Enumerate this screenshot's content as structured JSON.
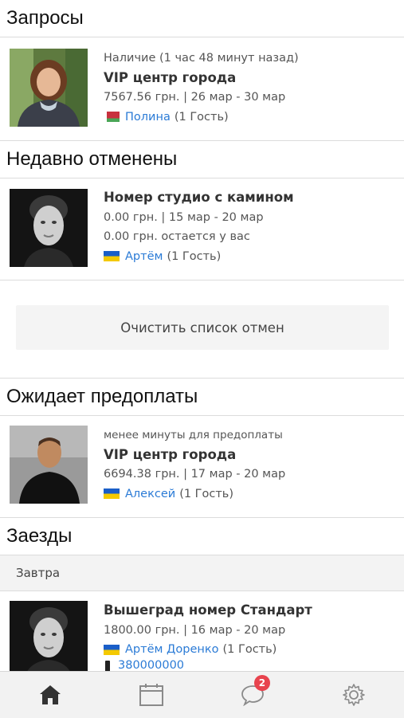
{
  "sections": {
    "requests": {
      "title": "Запросы",
      "card": {
        "status": "Наличие (1 час 48 минут назад)",
        "room": "VIP центр города",
        "price_dates": "7567.56 грн. | 26 мар - 30 мар",
        "flag": "by",
        "guest_name": "Полина",
        "guest_count": "(1 Гость)"
      }
    },
    "cancelled": {
      "title": "Недавно отменены",
      "card": {
        "room": "Номер студио с камином",
        "price_dates": "0.00 грн. | 15 мар - 20 мар",
        "remaining": "0.00 грн. остается у вас",
        "flag": "ua",
        "guest_name": "Артём",
        "guest_count": "(1 Гость)"
      },
      "clear_button": "Очистить список отмен"
    },
    "prepayment": {
      "title": "Ожидает предоплаты",
      "card": {
        "status": "менее минуты для предоплаты",
        "room": "VIP центр города",
        "price_dates": "6694.38 грн. | 17 мар - 20 мар",
        "flag": "ua",
        "guest_name": "Алексей",
        "guest_count": "(1 Гость)"
      }
    },
    "checkins": {
      "title": "Заезды",
      "subheader": "Завтра",
      "card": {
        "room": "Вышеград номер Стандарт",
        "price_dates": "1800.00 грн. | 16 мар - 20 мар",
        "flag": "ua",
        "guest_name": "Артём Доренко",
        "guest_count": "(1 Гость)",
        "phone": "380000000"
      }
    }
  },
  "tabbar": {
    "items": [
      "home-icon",
      "calendar-icon",
      "chat-icon",
      "settings-icon"
    ],
    "messages_badge": "2",
    "active_color": "#333333",
    "inactive_color": "#8a8a8a"
  },
  "colors": {
    "link": "#2b7bd6",
    "badge": "#e8434e"
  }
}
